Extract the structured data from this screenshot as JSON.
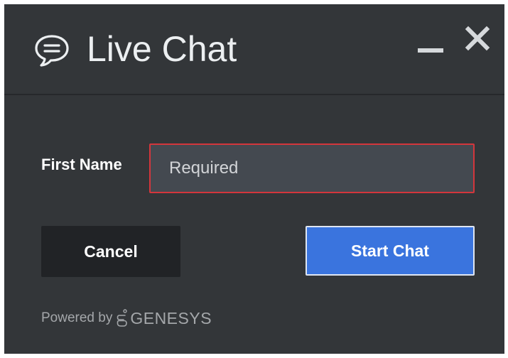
{
  "header": {
    "title": "Live Chat",
    "icons": {
      "chat": "chat-bubble-icon",
      "minimize": "minimize-icon",
      "close": "close-icon"
    }
  },
  "form": {
    "first_name_label": "First Name",
    "first_name_placeholder": "Required",
    "first_name_value": ""
  },
  "actions": {
    "cancel_label": "Cancel",
    "start_label": "Start Chat"
  },
  "footer": {
    "powered_by": "Powered by",
    "brand": "GENESYS",
    "brand_icon": "genesys-logo-icon"
  },
  "colors": {
    "panel_background": "#333639",
    "input_border_error": "#d4363c",
    "primary_button": "#3a74de",
    "cancel_button": "#212326"
  }
}
